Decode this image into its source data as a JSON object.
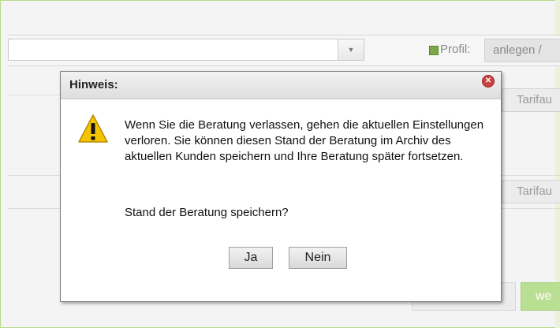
{
  "toolbar": {
    "profil_label": "Profil:",
    "profil_button": "anlegen /"
  },
  "background_buttons": {
    "tarif_1": "Tarifau",
    "tarif_2": "Tarifau",
    "weiter": "we"
  },
  "dialog": {
    "title": "Hinweis:",
    "message": "Wenn Sie die Beratung verlassen, gehen die aktuellen Einstellungen verloren. Sie können diesen Stand der Beratung im Archiv des aktuellen Kunden speichern und Ihre Beratung später fortsetzen.",
    "question": "Stand der Beratung speichern?",
    "yes_label": "Ja",
    "no_label": "Nein",
    "icons": {
      "warning": "warning-icon",
      "close": "close-icon"
    }
  },
  "colors": {
    "accent_green": "#b9df92",
    "warning_yellow": "#f5c400",
    "close_red": "#c84040"
  }
}
